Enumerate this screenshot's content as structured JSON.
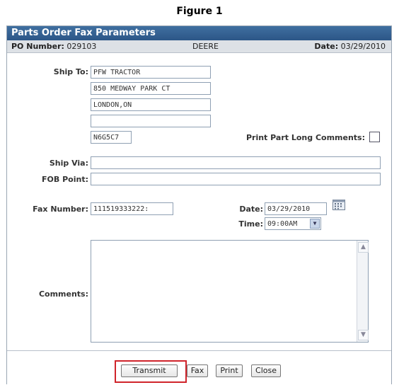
{
  "figure_caption": "Figure 1",
  "window": {
    "title": "Parts Order Fax Parameters"
  },
  "info": {
    "po_label": "PO Number:",
    "po_value": "029103",
    "vendor": "DEERE",
    "date_label": "Date:",
    "date_value": "03/29/2010"
  },
  "form": {
    "ship_to_label": "Ship To:",
    "ship_to_lines": [
      "PFW TRACTOR",
      "850 MEDWAY PARK CT",
      "LONDON,ON",
      "",
      "N6G5C7"
    ],
    "print_comments_label": "Print Part Long Comments:",
    "print_comments_checked": false,
    "ship_via_label": "Ship Via:",
    "ship_via_value": "",
    "fob_label": "FOB Point:",
    "fob_value": "",
    "fax_label": "Fax Number:",
    "fax_value": "111519333222:",
    "date_label": "Date:",
    "date_value": "03/29/2010",
    "time_label": "Time:",
    "time_value": "09:00AM",
    "comments_label": "Comments:",
    "comments_value": ""
  },
  "buttons": {
    "transmit": "Transmit",
    "fax": "Fax",
    "print": "Print",
    "close": "Close"
  },
  "icons": {
    "calendar": "calendar-icon",
    "dropdown": "chevron-down-icon",
    "scroll_up": "scroll-up-arrow-icon",
    "scroll_down": "scroll-down-arrow-icon"
  },
  "colors": {
    "titlebar": "#2c5687",
    "highlight": "#d0242b",
    "infobar": "#dde1e6"
  }
}
